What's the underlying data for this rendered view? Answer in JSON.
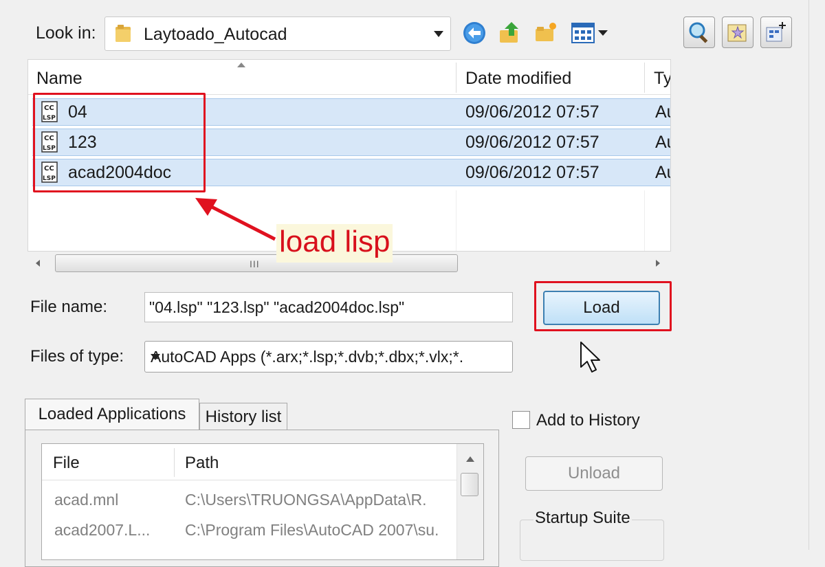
{
  "look_in": {
    "label": "Look in:",
    "value": "Laytoado_Autocad"
  },
  "toolbar_icons": [
    "back-icon",
    "up-folder-icon",
    "new-folder-icon",
    "views-icon"
  ],
  "right_icons": [
    "find-icon",
    "favorites-icon",
    "add-to-favorites-icon"
  ],
  "file_list": {
    "columns": [
      "Name",
      "Date modified",
      "Ty"
    ],
    "rows": [
      {
        "name": "04",
        "date": "09/06/2012 07:57",
        "type": "Au"
      },
      {
        "name": "123",
        "date": "09/06/2012 07:57",
        "type": "Au"
      },
      {
        "name": "acad2004doc",
        "date": "09/06/2012 07:57",
        "type": "Au"
      }
    ],
    "scroll_grip": "III"
  },
  "annotation": {
    "text": "load lisp",
    "color": "#e0111f"
  },
  "file_name": {
    "label": "File name:",
    "value": "\"04.lsp\" \"123.lsp\" \"acad2004doc.lsp\""
  },
  "files_of_type": {
    "label": "Files of type:",
    "value": "AutoCAD Apps (*.arx;*.lsp;*.dvb;*.dbx;*.vlx;*."
  },
  "load_button": "Load",
  "tabs": [
    "Loaded Applications",
    "History list"
  ],
  "loaded_apps": {
    "columns": [
      "File",
      "Path"
    ],
    "rows": [
      {
        "file": "acad.mnl",
        "path": "C:\\Users\\TRUONGSA\\AppData\\R."
      },
      {
        "file": "acad2007.L...",
        "path": "C:\\Program Files\\AutoCAD 2007\\su."
      }
    ]
  },
  "add_to_history": "Add to History",
  "unload_button": "Unload",
  "startup_suite": "Startup Suite"
}
